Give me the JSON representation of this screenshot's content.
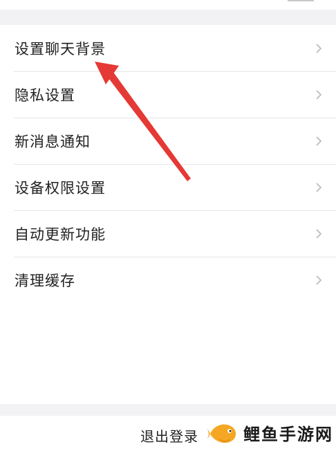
{
  "menu": {
    "items": [
      {
        "label": "设置聊天背景"
      },
      {
        "label": "隐私设置"
      },
      {
        "label": "新消息通知"
      },
      {
        "label": "设备权限设置"
      },
      {
        "label": "自动更新功能"
      },
      {
        "label": "清理缓存"
      }
    ]
  },
  "footer": {
    "logout_label": "退出登录"
  },
  "watermark": {
    "text": "鲤鱼手游网",
    "icon": "fish-logo-icon"
  },
  "annotation": {
    "arrow_color": "#e53935",
    "icon": "red-arrow-icon"
  },
  "colors": {
    "background": "#ffffff",
    "section_gap": "#f2f2f4",
    "divider": "#e6e6e6",
    "chevron": "#b8b8b8",
    "text": "#222222",
    "watermark_logo": "#f5a623"
  }
}
